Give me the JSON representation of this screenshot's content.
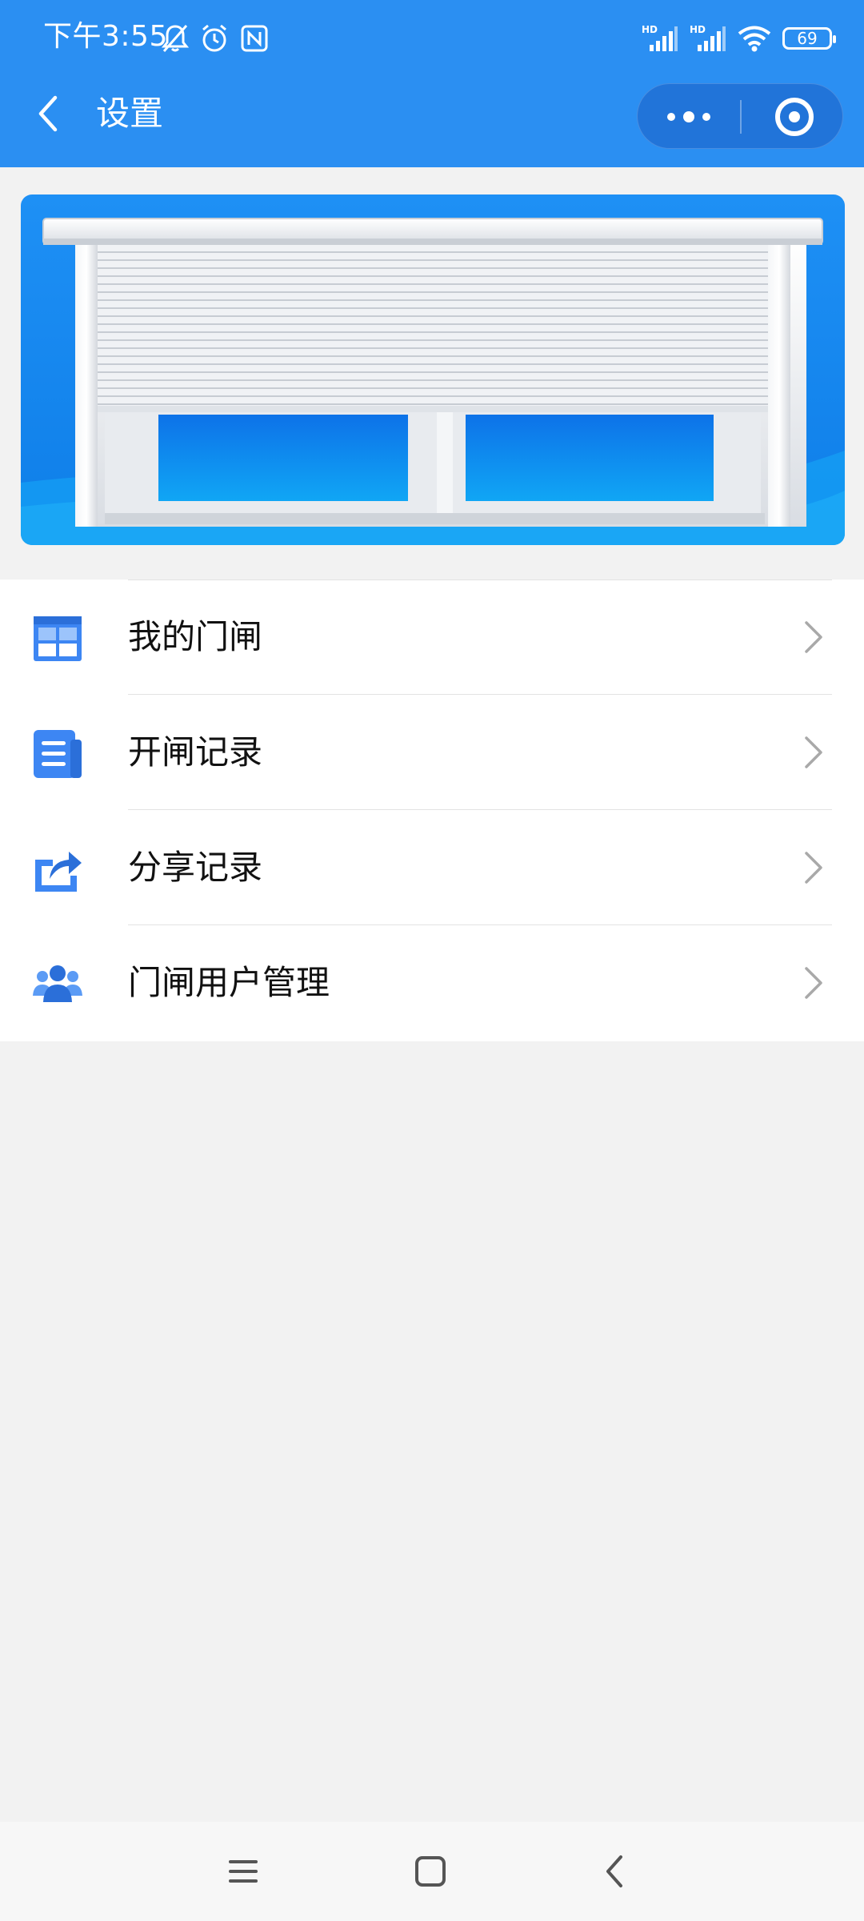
{
  "status_bar": {
    "time": "下午3:55",
    "battery_level": "69",
    "left_icons": [
      "bell-off-icon",
      "alarm-icon",
      "nfc-icon"
    ],
    "right_icons": [
      "hd-signal-icon",
      "hd-signal-icon",
      "wifi-icon",
      "battery-icon"
    ]
  },
  "nav": {
    "title": "设置",
    "back_icon": "chevron-left-icon",
    "capsule_more_icon": "more-dots-icon",
    "capsule_close_icon": "close-circle-icon"
  },
  "banner": {
    "image": "roller-shutter-window-illustration"
  },
  "menu": {
    "items": [
      {
        "label": "我的门闸",
        "icon": "gate-grid-icon"
      },
      {
        "label": "开闸记录",
        "icon": "document-list-icon"
      },
      {
        "label": "分享记录",
        "icon": "share-arrow-icon"
      },
      {
        "label": "门闸用户管理",
        "icon": "users-group-icon"
      }
    ]
  },
  "system_nav": {
    "menu_icon": "menu-lines-icon",
    "home_icon": "home-square-icon",
    "back_icon": "back-chevron-icon"
  },
  "colors": {
    "primary": "#2b8ff2",
    "capsule": "#2174d9",
    "icon_blue": "#3d86f3",
    "background": "#f2f2f2"
  }
}
